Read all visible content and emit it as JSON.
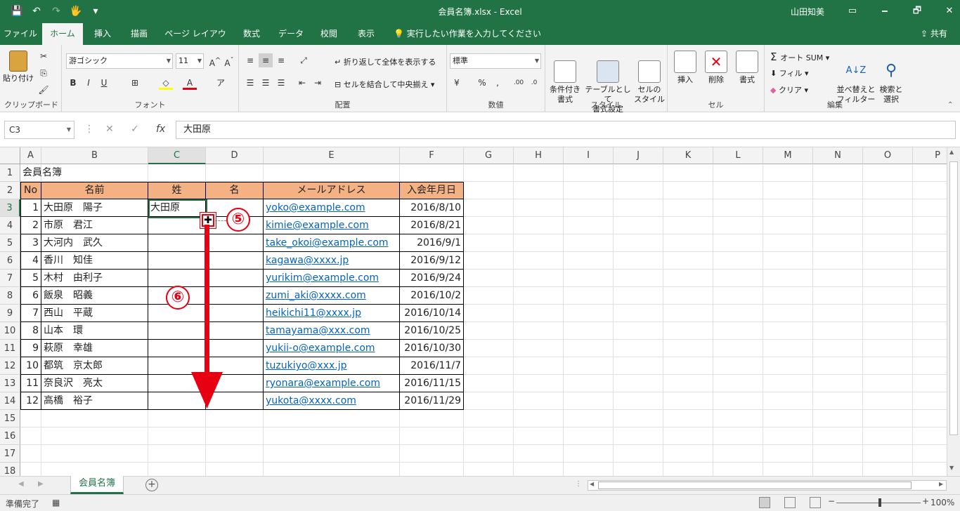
{
  "window": {
    "title": "会員名簿.xlsx  -  Excel",
    "user": "山田知美",
    "buttons": [
      "🗕",
      "🗗",
      "✕"
    ]
  },
  "qat": [
    "💾",
    "↶",
    "↷",
    "🖐",
    "▾"
  ],
  "tabs": [
    "ファイル",
    "ホーム",
    "挿入",
    "描画",
    "ページ レイアウト",
    "数式",
    "データ",
    "校閲",
    "表示"
  ],
  "tellme": "実行したい作業を入力してください",
  "share": "共有",
  "ribbon": {
    "clipboard": {
      "paste": "貼り付け",
      "label": "クリップボード"
    },
    "font": {
      "name": "游ゴシック",
      "size": "11",
      "label": "フォント"
    },
    "alignment": {
      "wrap": "折り返して全体を表示する",
      "merge": "セルを結合して中央揃え",
      "label": "配置"
    },
    "number": {
      "format": "標準",
      "label": "数値"
    },
    "styles": {
      "conditional": "条件付き\n書式",
      "table": "テーブルとして\n書式設定",
      "cell": "セルの\nスタイル",
      "label": "スタイル"
    },
    "cells": {
      "insert": "挿入",
      "delete": "削除",
      "format": "書式",
      "label": "セル"
    },
    "editing": {
      "autosum": "オート SUM",
      "fill": "フィル",
      "clear": "クリア",
      "sort": "並べ替えと\nフィルター",
      "find": "検索と\n選択",
      "label": "編集"
    }
  },
  "formula_bar": {
    "name_box": "C3",
    "content": "大田原"
  },
  "columns": [
    "A",
    "B",
    "C",
    "D",
    "E",
    "F",
    "G",
    "H",
    "I",
    "J",
    "K",
    "L",
    "M",
    "N",
    "O",
    "P"
  ],
  "rows": [
    "1",
    "2",
    "3",
    "4",
    "5",
    "6",
    "7",
    "8",
    "9",
    "10",
    "11",
    "12",
    "13",
    "14",
    "15",
    "16",
    "17",
    "18"
  ],
  "sheet": {
    "title": "会員名簿",
    "headers": [
      "No",
      "名前",
      "姓",
      "名",
      "メールアドレス",
      "入会年月日"
    ],
    "records": [
      {
        "no": "1",
        "name": "大田原　陽子",
        "sei": "大田原",
        "mei": "",
        "email": "yoko@example.com",
        "date": "2016/8/10"
      },
      {
        "no": "2",
        "name": "市原　君江",
        "sei": "",
        "mei": "",
        "email": "kimie@example.com",
        "date": "2016/8/21"
      },
      {
        "no": "3",
        "name": "大河内　武久",
        "sei": "",
        "mei": "",
        "email": "take_okoi@example.com",
        "date": "2016/9/1"
      },
      {
        "no": "4",
        "name": "香川　知佳",
        "sei": "",
        "mei": "",
        "email": "kagawa@xxxx.jp",
        "date": "2016/9/12"
      },
      {
        "no": "5",
        "name": "木村　由利子",
        "sei": "",
        "mei": "",
        "email": "yurikim@example.com",
        "date": "2016/9/24"
      },
      {
        "no": "6",
        "name": "飯泉　昭義",
        "sei": "",
        "mei": "",
        "email": "zumi_aki@xxxx.com",
        "date": "2016/10/2"
      },
      {
        "no": "7",
        "name": "西山　平蔵",
        "sei": "",
        "mei": "",
        "email": "heikichi11@xxxx.jp",
        "date": "2016/10/14"
      },
      {
        "no": "8",
        "name": "山本　環",
        "sei": "",
        "mei": "",
        "email": "tamayama@xxx.com",
        "date": "2016/10/25"
      },
      {
        "no": "9",
        "name": "萩原　幸雄",
        "sei": "",
        "mei": "",
        "email": "yukii-o@example.com",
        "date": "2016/10/30"
      },
      {
        "no": "10",
        "name": "都筑　京太郎",
        "sei": "",
        "mei": "",
        "email": "tuzukiyo@xxx.jp",
        "date": "2016/11/7"
      },
      {
        "no": "11",
        "name": "奈良沢　亮太",
        "sei": "",
        "mei": "",
        "email": "ryonara@example.com",
        "date": "2016/11/15"
      },
      {
        "no": "12",
        "name": "高橋　裕子",
        "sei": "",
        "mei": "",
        "email": "yukota@xxxx.com",
        "date": "2016/11/29"
      }
    ]
  },
  "annotations": {
    "step5": "⑤",
    "step6": "⑥"
  },
  "sheet_tab": "会員名簿",
  "status": {
    "ready": "準備完了",
    "zoom": "100%"
  },
  "colors": {
    "accent": "#217346",
    "header_fill": "#f4b183",
    "annotation": "#e60012",
    "link": "#0563c1"
  }
}
